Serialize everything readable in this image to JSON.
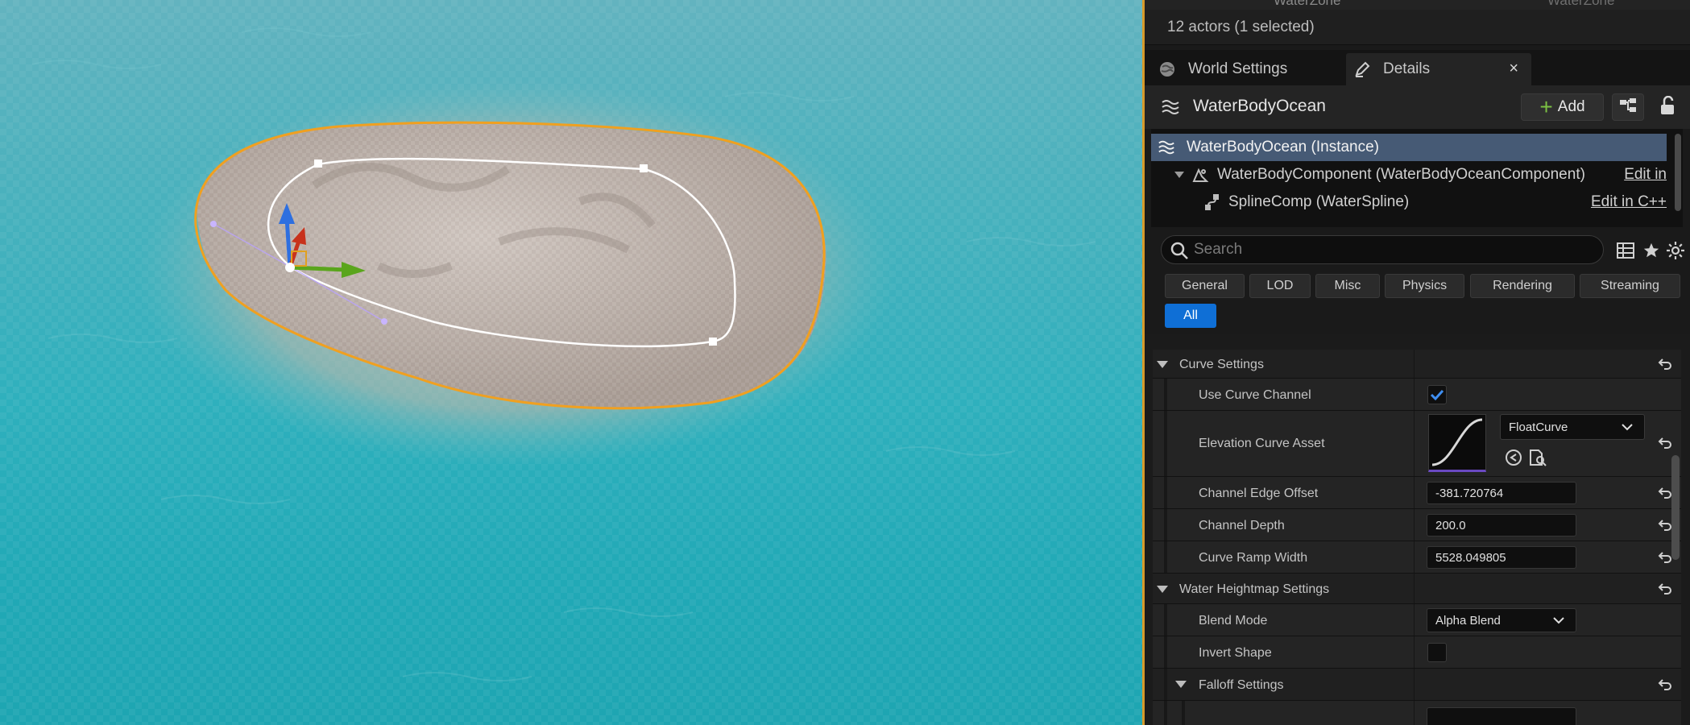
{
  "outliner": {
    "cut_name": "WaterZone",
    "cut_type": "WaterZone",
    "actor_count": "12 actors (1 selected)"
  },
  "tabs": {
    "world_settings": "World Settings",
    "details": "Details",
    "close": "×"
  },
  "header": {
    "title": "WaterBodyOcean",
    "add_label": "Add"
  },
  "components": {
    "root": "WaterBodyOcean (Instance)",
    "water_body_component": "WaterBodyComponent (WaterBodyOceanComponent)",
    "water_body_edit": "Edit in",
    "spline": "SplineComp (WaterSpline)",
    "spline_edit": "Edit in C++"
  },
  "search": {
    "placeholder": "Search"
  },
  "filters": [
    "General",
    "LOD",
    "Misc",
    "Physics",
    "Rendering",
    "Streaming",
    "All"
  ],
  "properties": {
    "curve_settings": {
      "title": "Curve Settings",
      "use_curve_channel": {
        "label": "Use Curve Channel",
        "checked": true
      },
      "elevation_curve_asset": {
        "label": "Elevation Curve Asset",
        "value": "FloatCurve"
      },
      "channel_edge_offset": {
        "label": "Channel Edge Offset",
        "value": "-381.720764"
      },
      "channel_depth": {
        "label": "Channel Depth",
        "value": "200.0"
      },
      "curve_ramp_width": {
        "label": "Curve Ramp Width",
        "value": "5528.049805"
      }
    },
    "water_heightmap_settings": {
      "title": "Water Heightmap Settings",
      "blend_mode": {
        "label": "Blend Mode",
        "value": "Alpha Blend"
      },
      "invert_shape": {
        "label": "Invert Shape",
        "checked": false
      },
      "falloff_settings": {
        "title": "Falloff Settings"
      }
    }
  },
  "colors": {
    "accent_blue": "#0f6fd6",
    "selection_row": "#465a75",
    "viewport_border": "#d79a2a",
    "spline_selected": "#f0a020"
  }
}
